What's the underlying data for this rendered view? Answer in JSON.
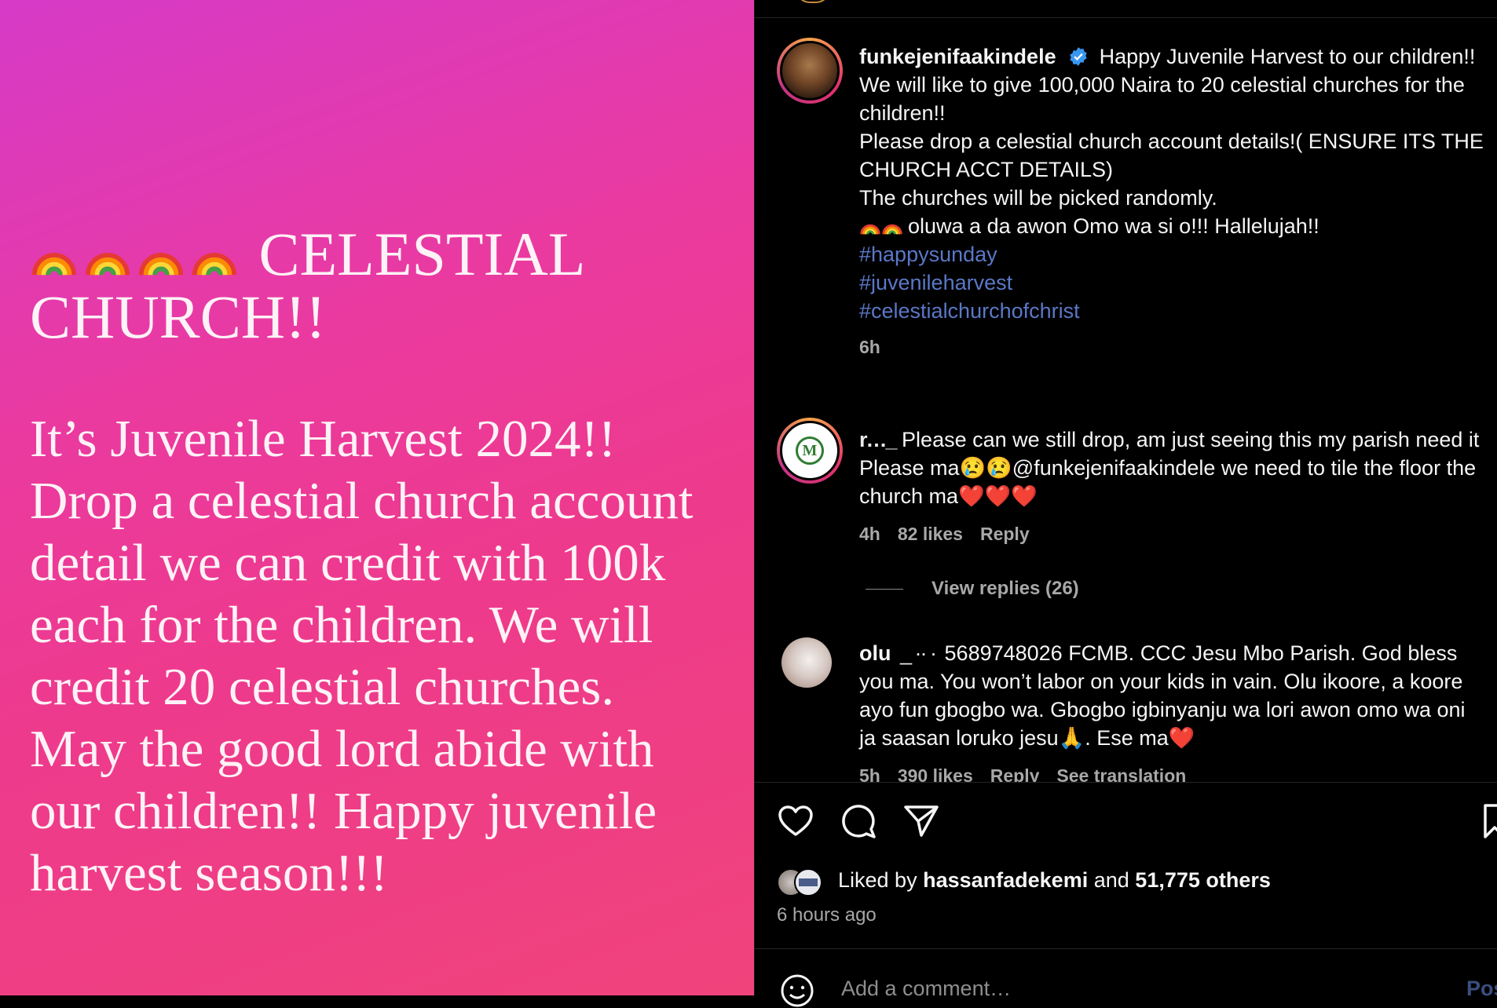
{
  "story": {
    "heading": "CELESTIAL CHURCH!!",
    "body": "It’s Juvenile Harvest 2024!! Drop a celestial church account detail we  can credit with 100k each for the children. We will credit 20 celestial churches. May the good lord abide with our children!! Happy juvenile harvest season!!!"
  },
  "post": {
    "username": "funkejenifaakindele",
    "caption_lines": [
      "Happy Juvenile Harvest to our children!!",
      "We will like to give 100,000 Naira to 20 celestial churches for the children!!",
      "Please drop a celestial church account details!( ENSURE ITS THE CHURCH ACCT DETAILS)",
      "The churches will be picked randomly.",
      "oluwa a da awon Omo wa si o!!! Hallelujah!!"
    ],
    "hashtags": [
      "#happysunday",
      "#juvenileharvest",
      "#celestialchurchofchrist"
    ],
    "time": "6h"
  },
  "comments": [
    {
      "username": "r…_",
      "text": "Please can we still drop, am just seeing this my parish need it Please ma😢😢@funkejenifaakindele we need to tile the floor the church ma❤️❤️❤️",
      "time": "4h",
      "likes": "82 likes",
      "reply": "Reply",
      "view_replies": "View replies (26)"
    },
    {
      "username": "olu",
      "text": "5689748026 FCMB. CCC Jesu Mbo Parish. God bless you ma. You won’t labor on your kids in vain. Olu ikoore, a koore ayo fun gbogbo wa. Gbogbo igbinyanju wa lori awon omo wa oni ja saasan loruko jesu🙏. Ese ma❤️",
      "time": "5h",
      "likes": "390 likes",
      "reply": "Reply",
      "translation": "See translation"
    }
  ],
  "likes": {
    "prefix": "Liked by",
    "user": "hassanfadekemi",
    "and": "and",
    "others": "51,775 others"
  },
  "time_ago": "6 hours ago",
  "add_comment": {
    "placeholder": "Add a comment…",
    "post_label": "Post"
  },
  "icons": [
    "rainbow-icon",
    "verified-icon",
    "heart-icon",
    "comment-icon",
    "share-icon",
    "bookmark-icon",
    "emoji-icon"
  ],
  "colors": {
    "hashtag": "#5b78c7",
    "muted": "#a8a8a8",
    "verified": "#3897f0"
  }
}
